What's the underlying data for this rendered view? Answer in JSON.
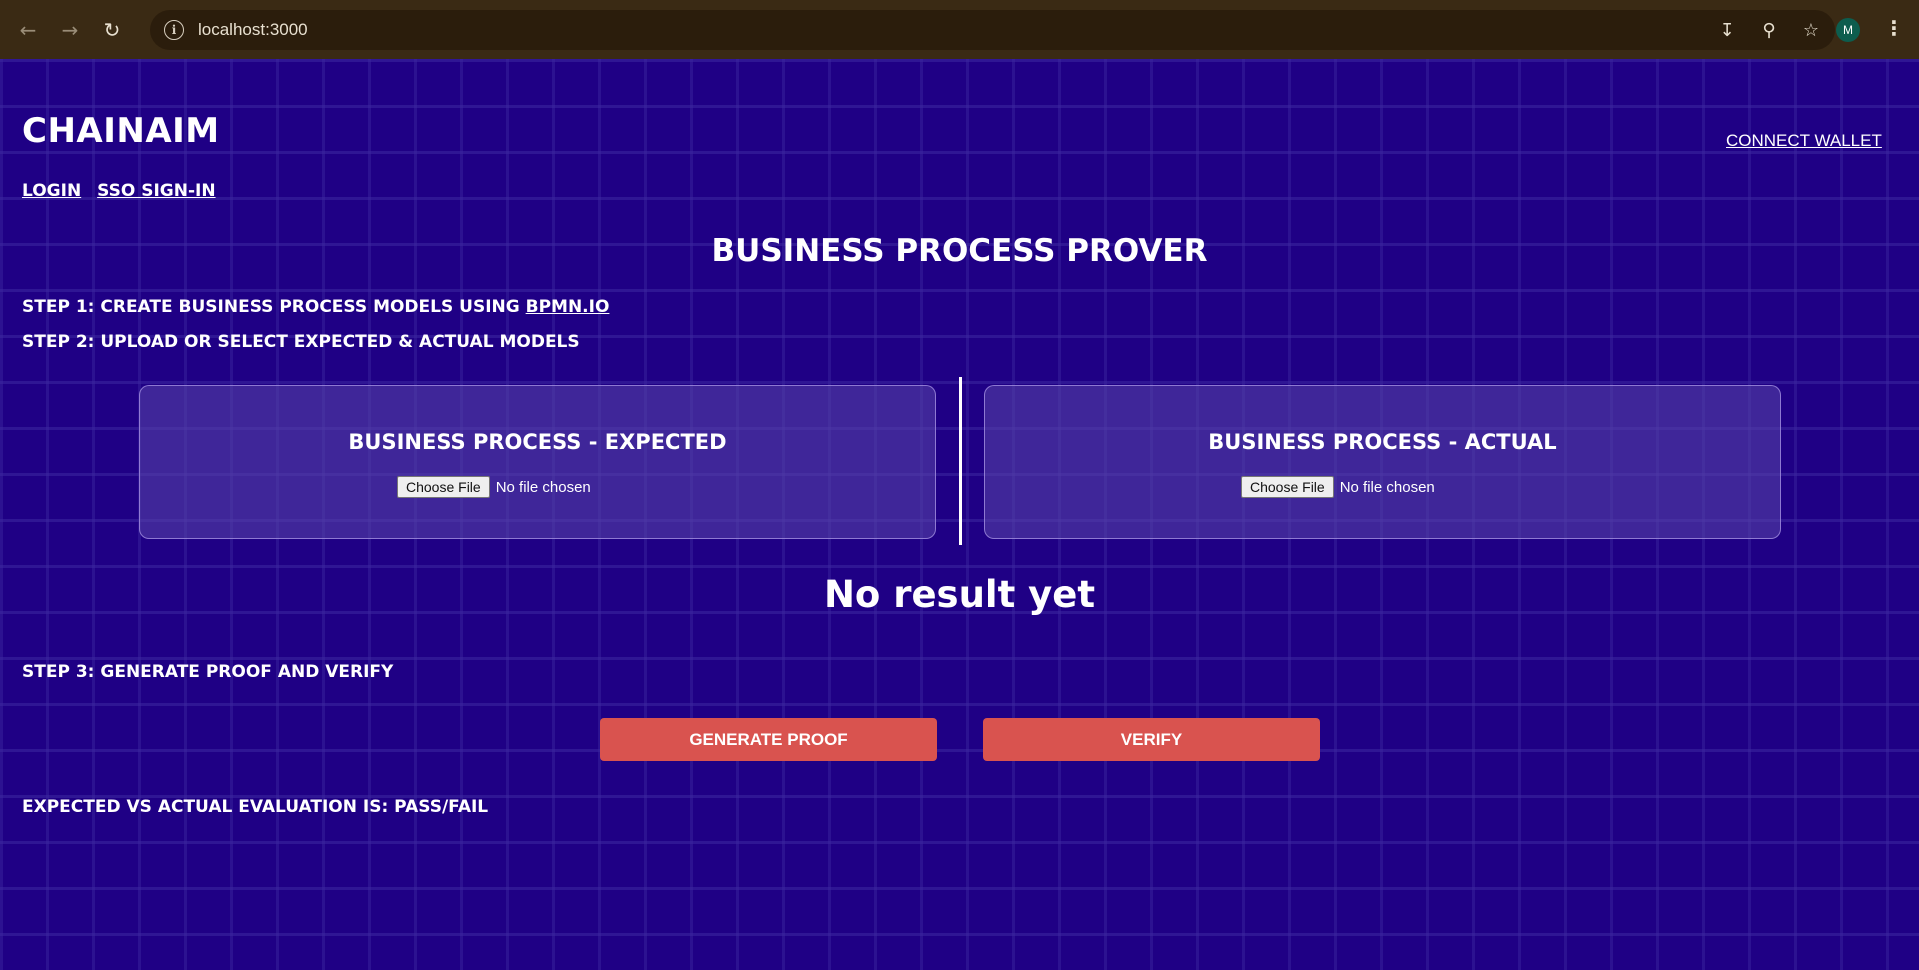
{
  "browser": {
    "url": "localhost:3000",
    "profile_initial": "M",
    "icons": [
      "back-icon",
      "forward-icon",
      "reload-icon",
      "site-info-icon",
      "install-icon",
      "zoom-icon",
      "bookmark-star-icon",
      "menu-icon"
    ]
  },
  "header": {
    "brand": "CHAINAIM",
    "connect_wallet": "CONNECT WALLET",
    "login": "LOGIN",
    "sso": "SSO SIGN-IN"
  },
  "main": {
    "title": "BUSINESS PROCESS PROVER",
    "step1_prefix": "STEP 1: CREATE BUSINESS PROCESS MODELS USING ",
    "step1_link": "BPMN.IO",
    "step2": "STEP 2: UPLOAD OR SELECT EXPECTED & ACTUAL MODELS",
    "expected": {
      "title": "BUSINESS PROCESS - EXPECTED",
      "button": "Choose File",
      "status": "No file chosen"
    },
    "actual": {
      "title": "BUSINESS PROCESS - ACTUAL",
      "button": "Choose File",
      "status": "No file chosen"
    },
    "result": "No result yet",
    "step3": "STEP 3: GENERATE PROOF AND VERIFY",
    "generate_label": "GENERATE PROOF",
    "verify_label": "VERIFY",
    "evaluation": "EXPECTED VS ACTUAL EVALUATION IS: PASS/FAIL"
  },
  "colors": {
    "background": "#1f0085",
    "button": "#d9534f",
    "chrome": "#3a2a14"
  }
}
